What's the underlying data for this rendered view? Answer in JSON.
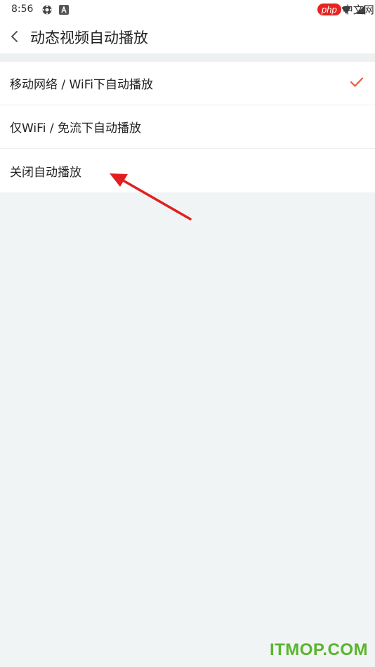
{
  "status_bar": {
    "time": "8:56",
    "icons": [
      "settings-gear-icon",
      "a-badge-icon",
      "wifi-icon",
      "signal-icon"
    ]
  },
  "watermark_top": {
    "php": "php",
    "cn": "中文网"
  },
  "header": {
    "back_icon": "chevron-left-icon",
    "title": "动态视频自动播放"
  },
  "options": [
    {
      "label": "移动网络 / WiFi下自动播放",
      "selected": true
    },
    {
      "label": "仅WiFi / 免流下自动播放",
      "selected": false
    },
    {
      "label": "关闭自动播放",
      "selected": false
    }
  ],
  "annotation": {
    "type": "red-arrow",
    "color": "#e02020"
  },
  "colors": {
    "accent": "#f0573c",
    "background": "#f1f4f5",
    "watermark_green": "#5ab52e"
  },
  "watermark_bottom": "ITMOP.COM"
}
